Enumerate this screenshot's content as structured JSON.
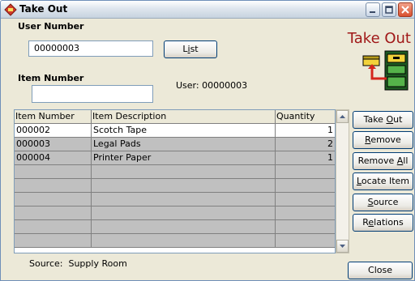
{
  "window": {
    "title": "Take Out"
  },
  "header_title": "Take Out",
  "user_number": {
    "label": "User Number",
    "value": "00000003"
  },
  "list_button": {
    "pre": "L",
    "ul": "i",
    "post": "st"
  },
  "item_number": {
    "label": "Item Number",
    "value": ""
  },
  "user_display": "User: 00000003",
  "table": {
    "columns": [
      "Item Number",
      "Item Description",
      "Quantity"
    ],
    "rows": [
      {
        "item": "000002",
        "desc": "Scotch Tape",
        "qty": "1"
      },
      {
        "item": "000003",
        "desc": "Legal Pads",
        "qty": "2"
      },
      {
        "item": "000004",
        "desc": "Printer Paper",
        "qty": "1"
      }
    ]
  },
  "buttons": {
    "take_out": {
      "pre": "Take ",
      "ul": "O",
      "post": "ut"
    },
    "remove": {
      "pre": "",
      "ul": "R",
      "post": "emove"
    },
    "remove_all": {
      "pre": "Remove ",
      "ul": "A",
      "post": "ll"
    },
    "locate": {
      "pre": "",
      "ul": "L",
      "post": "ocate Item"
    },
    "source": {
      "pre": "",
      "ul": "S",
      "post": "ource"
    },
    "relations": {
      "pre": "R",
      "ul": "e",
      "post": "lations"
    },
    "close": "Close"
  },
  "source_status": "Source:  Supply Room",
  "colors": {
    "accent": "#a01818",
    "row_selected": "#ffffff",
    "row_normal": "#c0c0c0"
  },
  "icons": [
    "take-out-app-icon",
    "take-out-illustration-icon",
    "minimize-icon",
    "maximize-icon",
    "close-icon",
    "scroll-up-icon",
    "scroll-down-icon"
  ]
}
